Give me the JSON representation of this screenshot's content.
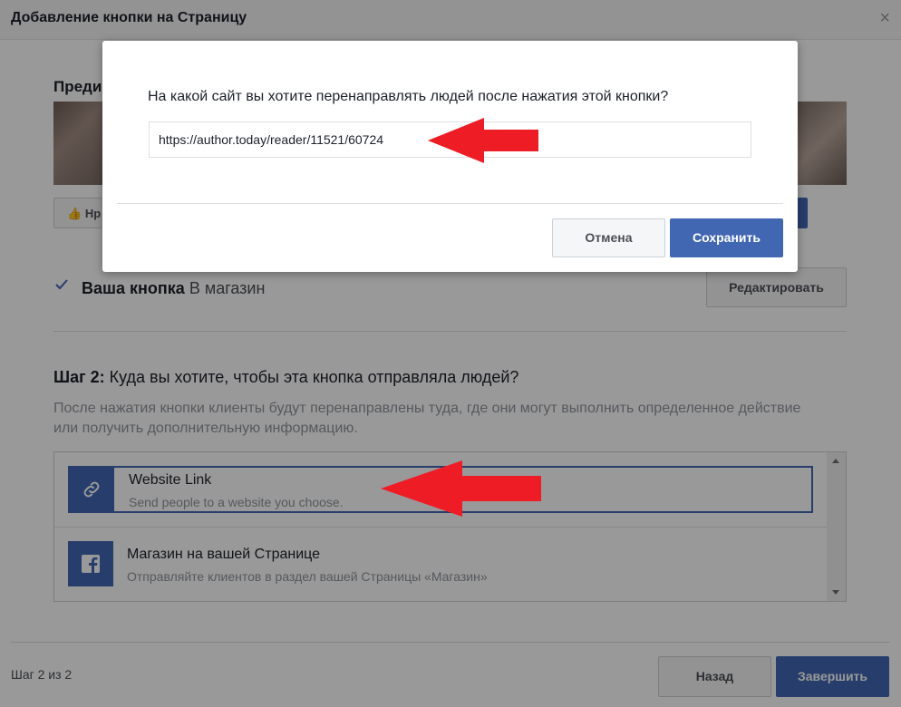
{
  "dialog": {
    "title": "Добавление кнопки на Страницу",
    "close_glyph": "×"
  },
  "preview": {
    "label_partial": "Преди",
    "like_partial": "Нр"
  },
  "your_button": {
    "label": "Ваша кнопка",
    "value": "В магазин",
    "edit_label": "Редактировать"
  },
  "step": {
    "prefix": "Шаг 2:",
    "question": "Куда вы хотите, чтобы эта кнопка отправляла людей?",
    "description": "После нажатия кнопки клиенты будут перенаправлены туда, где они могут выполнить определенное действие или получить дополнительную информацию."
  },
  "options": [
    {
      "title": "Website Link",
      "subtitle": "Send people to a website you choose.",
      "icon": "link-icon",
      "selected": true
    },
    {
      "title": "Магазин на вашей Странице",
      "subtitle": "Отправляйте клиентов в раздел вашей Страницы «Магазин»",
      "icon": "facebook-icon",
      "selected": false
    }
  ],
  "footer": {
    "step_count": "Шаг 2 из 2",
    "back_label": "Назад",
    "finish_label": "Завершить"
  },
  "modal": {
    "question": "На какой сайт вы хотите перенаправлять людей после нажатия этой кнопки?",
    "url_value": "https://author.today/reader/11521/60724",
    "cancel_label": "Отмена",
    "save_label": "Сохранить"
  },
  "colors": {
    "accent": "#4267b2",
    "annotation_arrow": "#ee1c24"
  }
}
